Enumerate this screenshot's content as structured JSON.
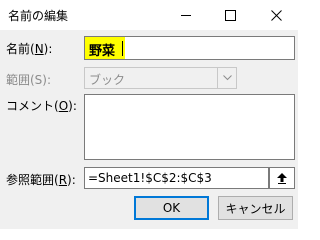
{
  "window": {
    "title": "名前の編集",
    "minimize_icon": "minimize-icon",
    "maximize_icon": "maximize-icon",
    "close_icon": "close-icon"
  },
  "name": {
    "label": "名前(",
    "accel": "N",
    "label_end": "):",
    "value": "野菜",
    "highlight_color": "#ffff00"
  },
  "scope": {
    "label": "範囲(S):",
    "value": "ブック",
    "dropdown_icon": "chevron-down-icon"
  },
  "comment": {
    "label": "コメント(",
    "accel": "O",
    "label_end": "):",
    "value": ""
  },
  "refers_to": {
    "label": "参照範囲(",
    "accel": "R",
    "label_end": "):",
    "value": "=Sheet1!$C$2:$C$3",
    "collapse_icon": "collapse-arrow-icon"
  },
  "buttons": {
    "ok": "OK",
    "cancel": "キャンセル",
    "accent_color": "#0078d7"
  }
}
